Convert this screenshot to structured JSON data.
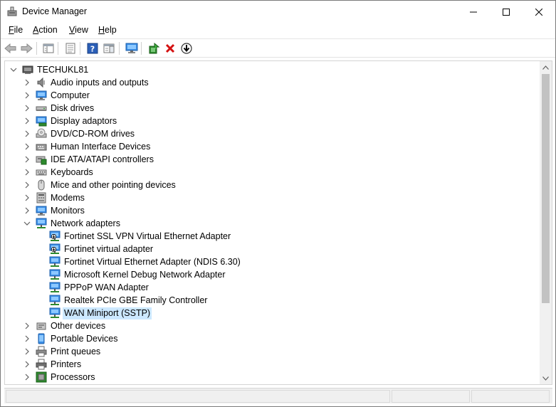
{
  "window": {
    "title": "Device Manager",
    "accent": "#0078d7",
    "selection_color": "#cce8ff"
  },
  "menu": [
    {
      "label": "File",
      "accel": "F",
      "rest": "ile"
    },
    {
      "label": "Action",
      "accel": "A",
      "rest": "ction"
    },
    {
      "label": "View",
      "accel": "V",
      "rest": "iew"
    },
    {
      "label": "Help",
      "accel": "H",
      "rest": "elp"
    }
  ],
  "toolbar": {
    "buttons": [
      "back-icon",
      "forward-icon",
      "properties-view-icon",
      "resources-icon",
      "help-icon",
      "action-pane-icon",
      "computer-monitor-icon",
      "update-driver-icon",
      "uninstall-icon",
      "download-icon"
    ]
  },
  "tree": {
    "root": {
      "label": "TECHUKL81",
      "expanded": true,
      "icon": "computer-icon"
    },
    "categories": [
      {
        "label": "Audio inputs and outputs",
        "icon": "speaker-icon",
        "expanded": false
      },
      {
        "label": "Computer",
        "icon": "computer-monitor-icon",
        "expanded": false
      },
      {
        "label": "Disk drives",
        "icon": "disk-drive-icon",
        "expanded": false
      },
      {
        "label": "Display adaptors",
        "icon": "display-adapter-icon",
        "expanded": false
      },
      {
        "label": "DVD/CD-ROM drives",
        "icon": "dvd-icon",
        "expanded": false
      },
      {
        "label": "Human Interface Devices",
        "icon": "hid-icon",
        "expanded": false
      },
      {
        "label": "IDE ATA/ATAPI controllers",
        "icon": "ide-controller-icon",
        "expanded": false
      },
      {
        "label": "Keyboards",
        "icon": "keyboard-icon",
        "expanded": false
      },
      {
        "label": "Mice and other pointing devices",
        "icon": "mouse-icon",
        "expanded": false
      },
      {
        "label": "Modems",
        "icon": "modem-icon",
        "expanded": false
      },
      {
        "label": "Monitors",
        "icon": "monitor-icon",
        "expanded": false
      },
      {
        "label": "Network adapters",
        "icon": "network-adapter-icon",
        "expanded": true,
        "children": [
          {
            "label": "Fortinet SSL VPN Virtual Ethernet Adapter",
            "icon": "network-adapter-icon",
            "badge": "down-arrow",
            "selected": false
          },
          {
            "label": "Fortinet virtual adapter",
            "icon": "network-adapter-icon",
            "badge": "down-arrow",
            "selected": false
          },
          {
            "label": "Fortinet Virtual Ethernet Adapter (NDIS 6.30)",
            "icon": "network-adapter-icon",
            "selected": false
          },
          {
            "label": "Microsoft Kernel Debug Network Adapter",
            "icon": "network-adapter-icon",
            "selected": false
          },
          {
            "label": "PPPoP WAN Adapter",
            "icon": "network-adapter-icon",
            "selected": false
          },
          {
            "label": "Realtek PCIe GBE Family Controller",
            "icon": "network-adapter-icon",
            "selected": false
          },
          {
            "label": "WAN Miniport (SSTP)",
            "icon": "network-adapter-icon",
            "selected": true
          }
        ]
      },
      {
        "label": "Other devices",
        "icon": "other-devices-icon",
        "expanded": false
      },
      {
        "label": "Portable Devices",
        "icon": "portable-device-icon",
        "expanded": false
      },
      {
        "label": "Print queues",
        "icon": "print-queue-icon",
        "expanded": false
      },
      {
        "label": "Printers",
        "icon": "printer-icon",
        "expanded": false
      },
      {
        "label": "Processors",
        "icon": "processor-icon",
        "expanded": false
      }
    ]
  }
}
